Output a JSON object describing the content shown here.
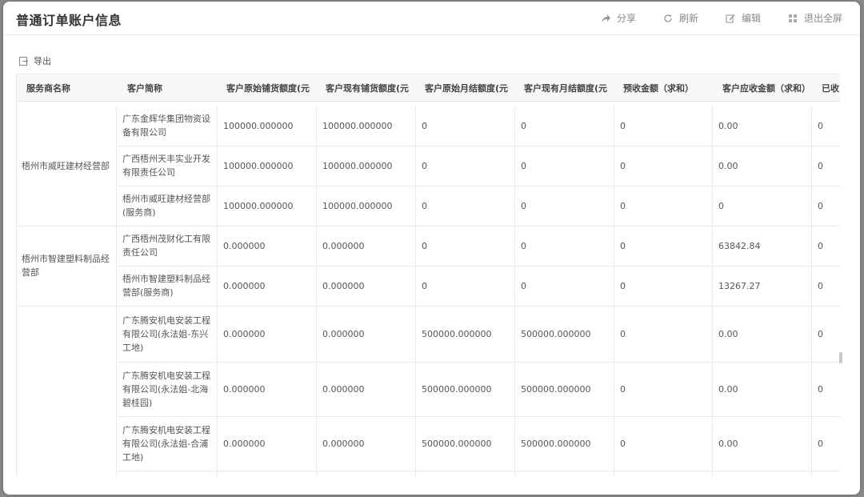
{
  "header": {
    "title": "普通订单账户信息",
    "actions": [
      {
        "label": "分享",
        "icon": "share-icon"
      },
      {
        "label": "刷新",
        "icon": "refresh-icon"
      },
      {
        "label": "编辑",
        "icon": "edit-icon"
      },
      {
        "label": "退出全屏",
        "icon": "exit-fullscreen-icon"
      }
    ]
  },
  "toolbar": {
    "export_label": "导出"
  },
  "table": {
    "columns": [
      "服务商名称",
      "客户简称",
      "客户原始铺货额度(元",
      "客户现有铺货额度(元",
      "客户原始月结额度(元",
      "客户现有月结额度(元",
      "预收金额（求和）",
      "客户应收金额（求和）",
      "已收"
    ],
    "groups": [
      {
        "provider": "梧州市威旺建材经营部"
      },
      {
        "provider": "梧州市智建塑料制品经营部"
      },
      {
        "provider": ""
      }
    ],
    "rows": [
      {
        "customer": "广东金辉华集团物资设备有限公司",
        "orig_goods": "100000.000000",
        "cur_goods": "100000.000000",
        "orig_month": "0",
        "cur_month": "0",
        "prepaid": "0",
        "receivable": "0.00",
        "received": "0"
      },
      {
        "customer": "广西梧州天丰实业开发有限责任公司",
        "orig_goods": "100000.000000",
        "cur_goods": "100000.000000",
        "orig_month": "0",
        "cur_month": "0",
        "prepaid": "0",
        "receivable": "0.00",
        "received": "0"
      },
      {
        "customer": "梧州市威旺建材经营部(服务商)",
        "orig_goods": "100000.000000",
        "cur_goods": "100000.000000",
        "orig_month": "0",
        "cur_month": "0",
        "prepaid": "0",
        "receivable": "0",
        "received": "0"
      },
      {
        "customer": "广西梧州茂财化工有限责任公司",
        "orig_goods": "0.000000",
        "cur_goods": "0.000000",
        "orig_month": "0",
        "cur_month": "0",
        "prepaid": "0",
        "receivable": "63842.84",
        "received": "0"
      },
      {
        "customer": "梧州市智建塑料制品经营部(服务商)",
        "orig_goods": "0.000000",
        "cur_goods": "0.000000",
        "orig_month": "0",
        "cur_month": "0",
        "prepaid": "0",
        "receivable": "13267.27",
        "received": "0"
      },
      {
        "customer": "广东腾安机电安装工程有限公司(永法姐-东兴工地)",
        "orig_goods": "0.000000",
        "cur_goods": "0.000000",
        "orig_month": "500000.000000",
        "cur_month": "500000.000000",
        "prepaid": "0",
        "receivable": "0.00",
        "received": "0"
      },
      {
        "customer": "广东腾安机电安装工程有限公司(永法姐-北海碧桂园)",
        "orig_goods": "0.000000",
        "cur_goods": "0.000000",
        "orig_month": "500000.000000",
        "cur_month": "500000.000000",
        "prepaid": "0",
        "receivable": "0.00",
        "received": "0"
      },
      {
        "customer": "广东腾安机电安装工程有限公司(永法姐-合浦工地)",
        "orig_goods": "0.000000",
        "cur_goods": "0.000000",
        "orig_month": "500000.000000",
        "cur_month": "500000.000000",
        "prepaid": "0",
        "receivable": "0.00",
        "received": "0"
      }
    ]
  }
}
